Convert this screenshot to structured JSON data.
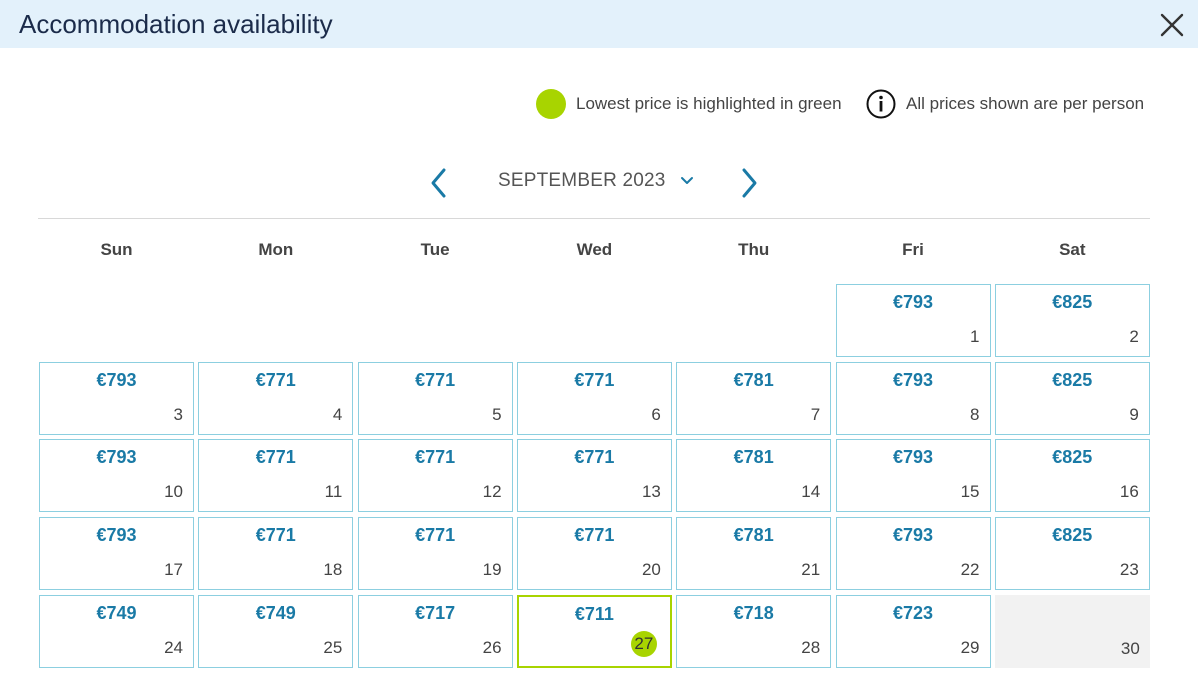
{
  "header": {
    "title": "Accommodation availability"
  },
  "legend": {
    "lowest_price_text": "Lowest price is highlighted in green",
    "per_person_text": "All prices shown are per person"
  },
  "calendar": {
    "month_label": "SEPTEMBER 2023",
    "weekdays": [
      "Sun",
      "Mon",
      "Tue",
      "Wed",
      "Thu",
      "Fri",
      "Sat"
    ],
    "start_weekday_index": 5,
    "days": [
      {
        "day": "1",
        "price": "€793"
      },
      {
        "day": "2",
        "price": "€825"
      },
      {
        "day": "3",
        "price": "€793"
      },
      {
        "day": "4",
        "price": "€771"
      },
      {
        "day": "5",
        "price": "€771"
      },
      {
        "day": "6",
        "price": "€771"
      },
      {
        "day": "7",
        "price": "€781"
      },
      {
        "day": "8",
        "price": "€793"
      },
      {
        "day": "9",
        "price": "€825"
      },
      {
        "day": "10",
        "price": "€793"
      },
      {
        "day": "11",
        "price": "€771"
      },
      {
        "day": "12",
        "price": "€771"
      },
      {
        "day": "13",
        "price": "€771"
      },
      {
        "day": "14",
        "price": "€781"
      },
      {
        "day": "15",
        "price": "€793"
      },
      {
        "day": "16",
        "price": "€825"
      },
      {
        "day": "17",
        "price": "€793"
      },
      {
        "day": "18",
        "price": "€771"
      },
      {
        "day": "19",
        "price": "€771"
      },
      {
        "day": "20",
        "price": "€771"
      },
      {
        "day": "21",
        "price": "€781"
      },
      {
        "day": "22",
        "price": "€793"
      },
      {
        "day": "23",
        "price": "€825"
      },
      {
        "day": "24",
        "price": "€749"
      },
      {
        "day": "25",
        "price": "€749"
      },
      {
        "day": "26",
        "price": "€717"
      },
      {
        "day": "27",
        "price": "€711",
        "lowest": true
      },
      {
        "day": "28",
        "price": "€718"
      },
      {
        "day": "29",
        "price": "€723"
      },
      {
        "day": "30",
        "price": "",
        "unavailable": true
      }
    ]
  },
  "colors": {
    "header_bg": "#e3f1fb",
    "price_blue": "#1a7aa6",
    "lowest_green": "#a8d400",
    "cell_border": "#8ccfe0"
  },
  "icons": {
    "close": "close-icon",
    "info": "info-icon",
    "prev": "chevron-left-icon",
    "next": "chevron-right-icon",
    "dropdown": "chevron-down-icon"
  }
}
